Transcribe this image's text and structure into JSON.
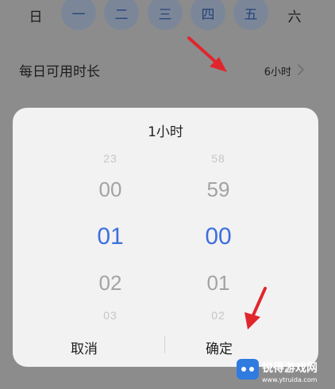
{
  "week_days": [
    "日",
    "一",
    "二",
    "三",
    "四",
    "五",
    "六"
  ],
  "selected_days": [
    "一",
    "二",
    "三",
    "四",
    "五"
  ],
  "duration": {
    "label": "每日可用时长",
    "value": "6小时"
  },
  "dialog": {
    "title": "1小时",
    "hours": [
      "23",
      "00",
      "01",
      "02",
      "03"
    ],
    "hours_selected": "01",
    "minutes": [
      "58",
      "59",
      "00",
      "01",
      "02"
    ],
    "minutes_selected": "00",
    "cancel_label": "取消",
    "confirm_label": "确定"
  },
  "watermark": {
    "name": "锐得游戏网",
    "url": "www.ytruida.com"
  },
  "colors": {
    "overlay_bg": "#8c8c8c",
    "dialog_bg": "#f2f2f2",
    "accent": "#3f6fdc",
    "arrow": "#e0262c"
  }
}
